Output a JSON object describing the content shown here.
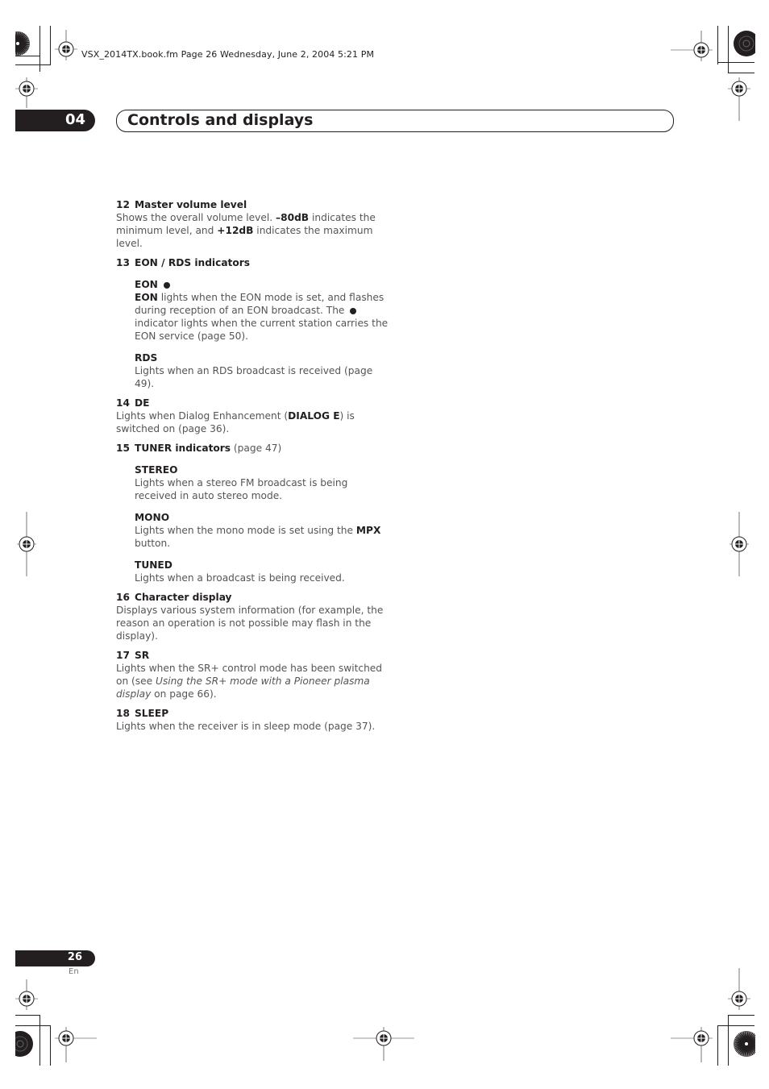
{
  "print_header": "VSX_2014TX.book.fm  Page 26  Wednesday, June 2, 2004  5:21 PM",
  "chapter": {
    "number": "04",
    "title": "Controls and displays"
  },
  "items": [
    {
      "num": "12",
      "title": "Master volume level",
      "desc": [
        {
          "t": "Shows the overall volume level. "
        },
        {
          "b": "–80dB"
        },
        {
          "t": " indicates the minimum level, and "
        },
        {
          "b": "+12dB"
        },
        {
          "t": " indicates the maximum level."
        }
      ]
    },
    {
      "num": "13",
      "title": "EON / RDS indicators",
      "subs": [
        {
          "title": "EON",
          "dot": true,
          "desc": [
            {
              "b": "EON"
            },
            {
              "t": " lights when the EON mode is set, and flashes during reception of an EON broadcast. The "
            },
            {
              "dot": true
            },
            {
              "t": " indicator lights when the current station carries the EON service (page 50)."
            }
          ]
        },
        {
          "title": "RDS",
          "desc": [
            {
              "t": "Lights when an RDS broadcast is received (page 49)."
            }
          ]
        }
      ]
    },
    {
      "num": "14",
      "title": "DE",
      "desc": [
        {
          "t": "Lights when Dialog Enhancement ("
        },
        {
          "b": "DIALOG E"
        },
        {
          "t": ") is switched on (page 36)."
        }
      ]
    },
    {
      "num": "15",
      "title": "TUNER indicators",
      "ref": "(page 47)",
      "subs": [
        {
          "title": "STEREO",
          "desc": [
            {
              "t": "Lights when a stereo FM broadcast is being received in auto stereo mode."
            }
          ]
        },
        {
          "title": "MONO",
          "desc": [
            {
              "t": "Lights when the mono mode is set using the "
            },
            {
              "b": "MPX"
            },
            {
              "t": " button."
            }
          ]
        },
        {
          "title": "TUNED",
          "desc": [
            {
              "t": "Lights when a broadcast is being received."
            }
          ]
        }
      ]
    },
    {
      "num": "16",
      "title": "Character display",
      "desc": [
        {
          "t": "Displays various system information (for example, the reason an operation is not possible may flash in the display)."
        }
      ]
    },
    {
      "num": "17",
      "title": "SR",
      "desc": [
        {
          "t": "Lights when the SR+ control mode has been switched on (see "
        },
        {
          "i": "Using the SR+ mode with a Pioneer plasma display"
        },
        {
          "t": " on page 66)."
        }
      ]
    },
    {
      "num": "18",
      "title": "SLEEP",
      "desc": [
        {
          "t": "Lights when the receiver is in sleep mode (page 37)."
        }
      ]
    }
  ],
  "footer": {
    "page_number": "26",
    "language": "En"
  },
  "icons": {
    "registration_mark": "crosshair-target-icon",
    "color_bar": "starburst-target-icon",
    "bullet": "filled-circle-icon"
  },
  "colors": {
    "ink": "#231f20",
    "body_text": "#555555"
  }
}
